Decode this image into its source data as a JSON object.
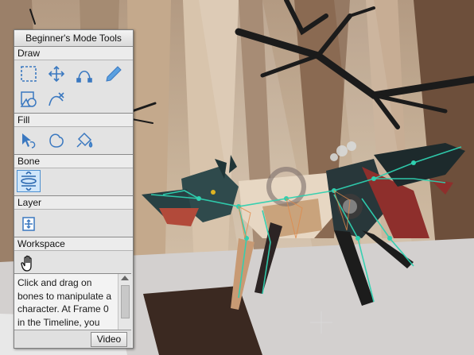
{
  "panel": {
    "title": "Beginner's Mode Tools",
    "sections": {
      "draw": "Draw",
      "fill": "Fill",
      "bone": "Bone",
      "layer": "Layer",
      "workspace": "Workspace"
    },
    "tools": {
      "draw": [
        "select-points-icon",
        "transform-points-icon",
        "add-point-icon",
        "freehand-icon",
        "draw-shape-icon",
        "delete-edge-icon"
      ],
      "fill": [
        "select-shape-icon",
        "create-shape-icon",
        "paint-bucket-icon"
      ],
      "bone": [
        "manipulate-bones-icon"
      ],
      "layer": [
        "transform-layer-icon"
      ],
      "workspace": [
        "hand-pan-icon"
      ]
    },
    "active_tool": "manipulate-bones-icon",
    "help_text": "Click and drag on bones to manipulate a character. At Frame 0 in the Timeline, you",
    "video_label": "Video"
  },
  "colors": {
    "accent": "#4d8fd0",
    "bone_color": "#2fd0b0",
    "panel_bg": "#e6e6e6"
  }
}
